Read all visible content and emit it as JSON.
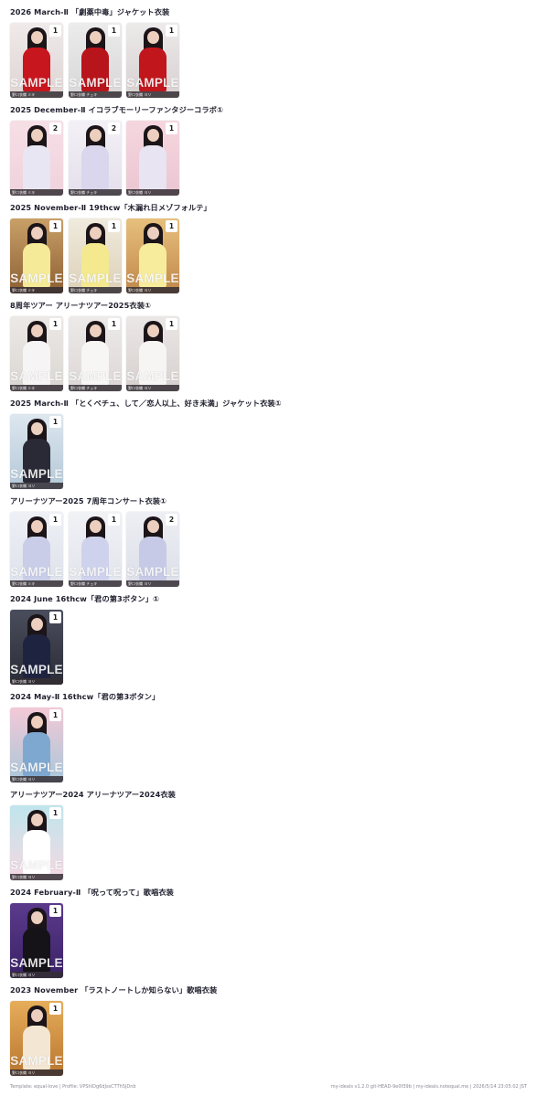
{
  "sections": [
    {
      "title": "2026 March-Ⅱ 「劇薬中毒」ジャケット衣装",
      "cards": [
        {
          "count": "1",
          "watermark": "SAMPLE",
          "caption": "野口衣織 ミキ",
          "bg": "linear-gradient(#f0eaea,#ded4d4)",
          "outfit": "#c8161e"
        },
        {
          "count": "1",
          "watermark": "SAMPLE",
          "caption": "野口衣織 チェキ",
          "bg": "linear-gradient(#ececec,#d8d6d6)",
          "outfit": "#b8141b"
        },
        {
          "count": "1",
          "watermark": "SAMPLE",
          "caption": "野口衣織 ヨリ",
          "bg": "linear-gradient(#eceaea,#d8d0d0)",
          "outfit": "#c0161c"
        }
      ]
    },
    {
      "title": "2025 December-Ⅱ イコラブモーリーファンタジーコラボ①",
      "cards": [
        {
          "count": "2",
          "watermark": "",
          "caption": "野口衣織 ミキ",
          "bg": "linear-gradient(#f7dfe6,#efd2dc)",
          "outfit": "#e9e6f3"
        },
        {
          "count": "2",
          "watermark": "",
          "caption": "野口衣織 チェキ",
          "bg": "linear-gradient(#f3f0f6,#e5e0ec)",
          "outfit": "#d9d6ee"
        },
        {
          "count": "1",
          "watermark": "",
          "caption": "野口衣織 ヨリ",
          "bg": "linear-gradient(#f5d6df,#ebc6d2)",
          "outfit": "#e8e4f2"
        }
      ]
    },
    {
      "title": "2025 November-Ⅱ 19thcw「木漏れ日メゾフォルテ」",
      "cards": [
        {
          "count": "1",
          "watermark": "SAMPLE",
          "caption": "野口衣織 ミキ",
          "bg": "linear-gradient(#c9a068,#8d5f33)",
          "outfit": "#f5ea97"
        },
        {
          "count": "1",
          "watermark": "SAMPLE",
          "caption": "野口衣織 チェキ",
          "bg": "linear-gradient(#f0ebdd,#ddd0b8)",
          "outfit": "#f4e98f"
        },
        {
          "count": "1",
          "watermark": "SAMPLE",
          "caption": "野口衣織 ヨリ",
          "bg": "linear-gradient(#e7c07d,#c1874a)",
          "outfit": "#f6ec9c"
        }
      ]
    },
    {
      "title": "8周年ツアー アリーナツアー2025衣装①",
      "cards": [
        {
          "count": "1",
          "watermark": "SAMPLE",
          "caption": "野口衣織 ミキ",
          "bg": "linear-gradient(#ece9e6,#dad6d2)",
          "outfit": "#f6f4f4"
        },
        {
          "count": "1",
          "watermark": "SAMPLE",
          "caption": "野口衣織 チェキ",
          "bg": "linear-gradient(#eeeaea,#ddd6d6)",
          "outfit": "#f8f5f5"
        },
        {
          "count": "1",
          "watermark": "SAMPLE",
          "caption": "野口衣織 ヨリ",
          "bg": "linear-gradient(#ebe7e6,#d6d0ce)",
          "outfit": "#f7f4f4"
        }
      ]
    },
    {
      "title": "2025 March-Ⅱ 「とくベチュ、して／恋人以上、好き未満」ジャケット衣装①",
      "cards": [
        {
          "count": "1",
          "watermark": "SAMPLE",
          "caption": "野口衣織 ヨリ",
          "bg": "linear-gradient(#dde7ef,#b4c8d8)",
          "outfit": "#2a2a36"
        }
      ]
    },
    {
      "title": "アリーナツアー2025 7周年コンサート衣装①",
      "cards": [
        {
          "count": "1",
          "watermark": "SAMPLE",
          "caption": "野口衣織 ミキ",
          "bg": "linear-gradient(#eef0f5,#dde1ea)",
          "outfit": "#c9cde8"
        },
        {
          "count": "1",
          "watermark": "SAMPLE",
          "caption": "野口衣織 チェキ",
          "bg": "linear-gradient(#f1f2f6,#e2e4ec)",
          "outfit": "#cfd2ec"
        },
        {
          "count": "2",
          "watermark": "SAMPLE",
          "caption": "野口衣織 ヨリ",
          "bg": "linear-gradient(#eeeff4,#dcdee8)",
          "outfit": "#c6cae6"
        }
      ]
    },
    {
      "title": "2024 June 16thcw「君の第3ボタン」①",
      "cards": [
        {
          "count": "1",
          "watermark": "SAMPLE",
          "caption": "野口衣織 ヨリ",
          "bg": "linear-gradient(#4a4d5c,#2a2c36)",
          "outfit": "#1e2340"
        }
      ]
    },
    {
      "title": "2024 May-Ⅱ 16thcw「君の第3ボタン」",
      "cards": [
        {
          "count": "1",
          "watermark": "SAMPLE",
          "caption": "野口衣織 ヨリ",
          "bg": "linear-gradient(#f3c9d6,#a9c7da)",
          "outfit": "#7fa8d0"
        }
      ]
    },
    {
      "title": "アリーナツアー2024 アリーナツアー2024衣装",
      "cards": [
        {
          "count": "1",
          "watermark": "SAMPLE",
          "caption": "野口衣織 ヨリ",
          "bg": "linear-gradient(#bfe5ec,#f5d8e2)",
          "outfit": "#ffffff"
        }
      ]
    },
    {
      "title": "2024 February-Ⅱ 「呪って呪って」歌唱衣装",
      "cards": [
        {
          "count": "1",
          "watermark": "SAMPLE",
          "caption": "野口衣織 ヨリ",
          "bg": "linear-gradient(#5b3a8c,#3a2266)",
          "outfit": "#151218"
        }
      ]
    },
    {
      "title": "2023 November 「ラストノートしか知らない」歌唱衣装",
      "cards": [
        {
          "count": "1",
          "watermark": "SAMPLE",
          "caption": "野口衣織 ヨリ",
          "bg": "linear-gradient(#e6ad5a,#b9762f)",
          "outfit": "#f3e6d2"
        }
      ]
    }
  ],
  "footer": {
    "left": "Template: equal-love | Profile: VPShlDg6dJssCTTh5jDnb",
    "right": "my-ideals v1.2.0 git-HEAD-9e0f39b | my-ideals.notequal.me | 2026/5/14 23:05:02 JST"
  }
}
